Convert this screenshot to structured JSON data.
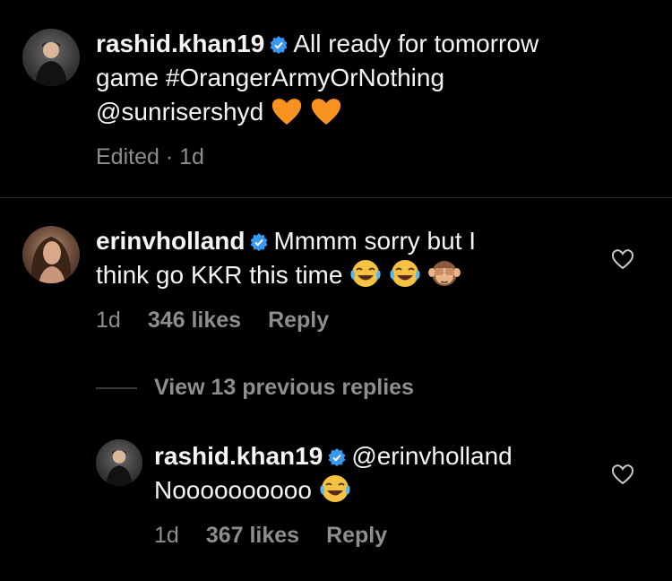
{
  "caption": {
    "username": "rashid.khan19",
    "text_part1": "All ready for tomorrow",
    "text_part2": "game #OrangerArmyOrNothing",
    "text_part3": "@sunrisershyd",
    "meta": "Edited · 1d",
    "emoji": [
      "orange-heart",
      "orange-heart"
    ]
  },
  "comment": {
    "username": "erinvholland",
    "text_part1": "Mmmm sorry but I",
    "text_part2": "think go KKR this time",
    "time": "1d",
    "likes": "346 likes",
    "reply": "Reply",
    "emoji": [
      "face-with-tears-of-joy",
      "face-with-tears-of-joy",
      "see-no-evil-monkey"
    ]
  },
  "view_replies": "View 13 previous replies",
  "reply": {
    "username": "rashid.khan19",
    "mention": "@erinvholland",
    "text": "Noooooooooo",
    "time": "1d",
    "likes": "367 likes",
    "reply": "Reply",
    "emoji": [
      "face-with-tears-of-joy"
    ]
  },
  "colors": {
    "background": "#000000",
    "text": "#f5f5f5",
    "muted": "#8e8e8e",
    "verified": "#3897f0",
    "orange_heart": "#f7931e"
  }
}
